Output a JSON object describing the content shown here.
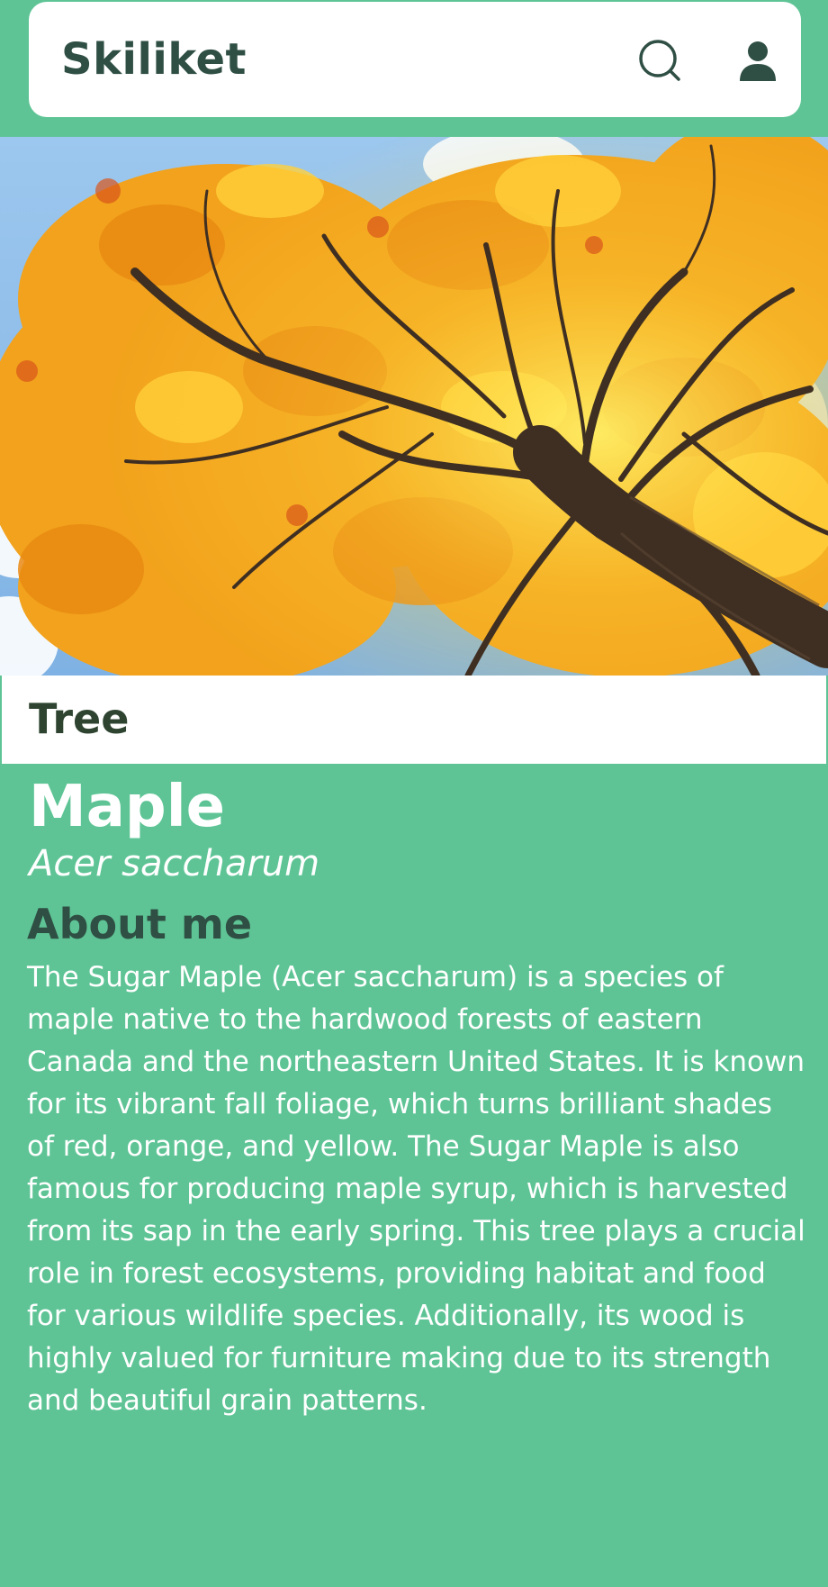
{
  "header": {
    "brand": "Skiliket",
    "search_icon": "search-icon",
    "account_icon": "user-icon"
  },
  "hero": {
    "image_subject": "autumn sugar maple canopy viewed from below",
    "colors": {
      "sky": "#8fbde8",
      "foliage": "#f2a21c",
      "trunk": "#4a3a2c"
    }
  },
  "plant": {
    "type": "Tree",
    "common_name": "Maple",
    "scientific_name": "Acer saccharum"
  },
  "about": {
    "heading": "About me",
    "body": "The Sugar Maple (Acer saccharum) is a species of maple native to the hardwood forests of eastern Canada and the northeastern United States. It is known for its vibrant fall foliage, which turns brilliant shades of red, orange, and yellow. The Sugar Maple is also famous for producing maple syrup, which is harvested from its sap in the early spring. This tree plays a crucial role in forest ecosystems, providing habitat and food for various wildlife species. Additionally, its wood is highly valued for furniture making due to its strength and beautiful grain patterns."
  },
  "theme": {
    "accent": "#5ec495",
    "header_text": "#2f4f44",
    "card_bg": "#ffffff"
  }
}
